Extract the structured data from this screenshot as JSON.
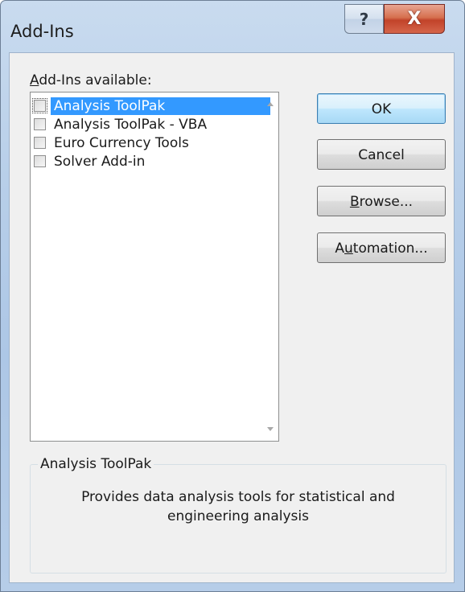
{
  "window": {
    "title": "Add-Ins",
    "help_glyph": "?",
    "close_glyph": "X"
  },
  "list": {
    "label": "Add-Ins available:",
    "items": [
      {
        "label": "Analysis ToolPak",
        "checked": false,
        "selected": true
      },
      {
        "label": "Analysis ToolPak - VBA",
        "checked": false,
        "selected": false
      },
      {
        "label": "Euro Currency Tools",
        "checked": false,
        "selected": false
      },
      {
        "label": "Solver Add-in",
        "checked": false,
        "selected": false
      }
    ]
  },
  "buttons": {
    "ok": "OK",
    "cancel": "Cancel",
    "browse_pre": "",
    "browse_key": "B",
    "browse_post": "rowse...",
    "automation_pre": "A",
    "automation_key": "u",
    "automation_post": "tomation..."
  },
  "details": {
    "title": "Analysis ToolPak",
    "description": "Provides data analysis tools for statistical and engineering analysis"
  },
  "colors": {
    "selection": "#3399ff",
    "dialog_bg": "#f0f0f0",
    "close_button": "#c2432a"
  }
}
